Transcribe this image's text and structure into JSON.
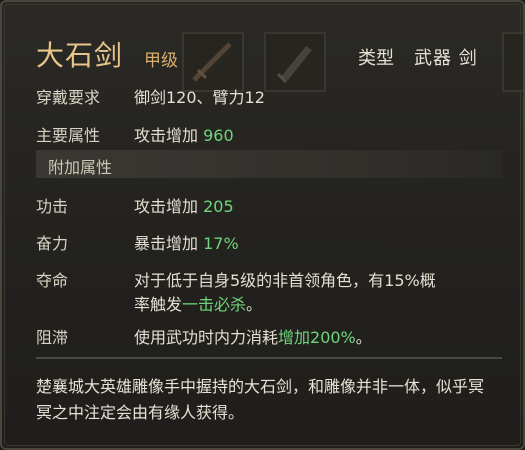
{
  "item": {
    "name": "大石剑",
    "grade": "甲级",
    "type_label": "类型",
    "type_value": "武器 剑"
  },
  "requirement": {
    "label": "穿戴要求",
    "value": "御剑120、臂力12"
  },
  "main_attr": {
    "label": "主要属性",
    "stat": "攻击增加",
    "number": "960"
  },
  "extra_section": {
    "title": "附加属性"
  },
  "extra_attrs": [
    {
      "label": "功击",
      "stat": "攻击增加",
      "number": "205"
    },
    {
      "label": "奋力",
      "stat": "暴击增加",
      "number": "17%"
    }
  ],
  "special_1": {
    "label": "夺命",
    "line1": "对于低于自身5级的非首领角色，有15%概",
    "line2_prefix": "率触发",
    "line2_highlight": "一击必杀",
    "line2_suffix": "。"
  },
  "special_2": {
    "label": "阻滞",
    "prefix": "使用武功时内力消耗",
    "highlight": "增加200%",
    "suffix": "。"
  },
  "description": "楚襄城大英雄雕像手中握持的大石剑，和雕像并非一体，似乎冥冥之中注定会由有缘人获得。",
  "colors": {
    "name": "#e9c48a",
    "highlight_green": "#6fd57a",
    "text": "#e3dfd3"
  }
}
